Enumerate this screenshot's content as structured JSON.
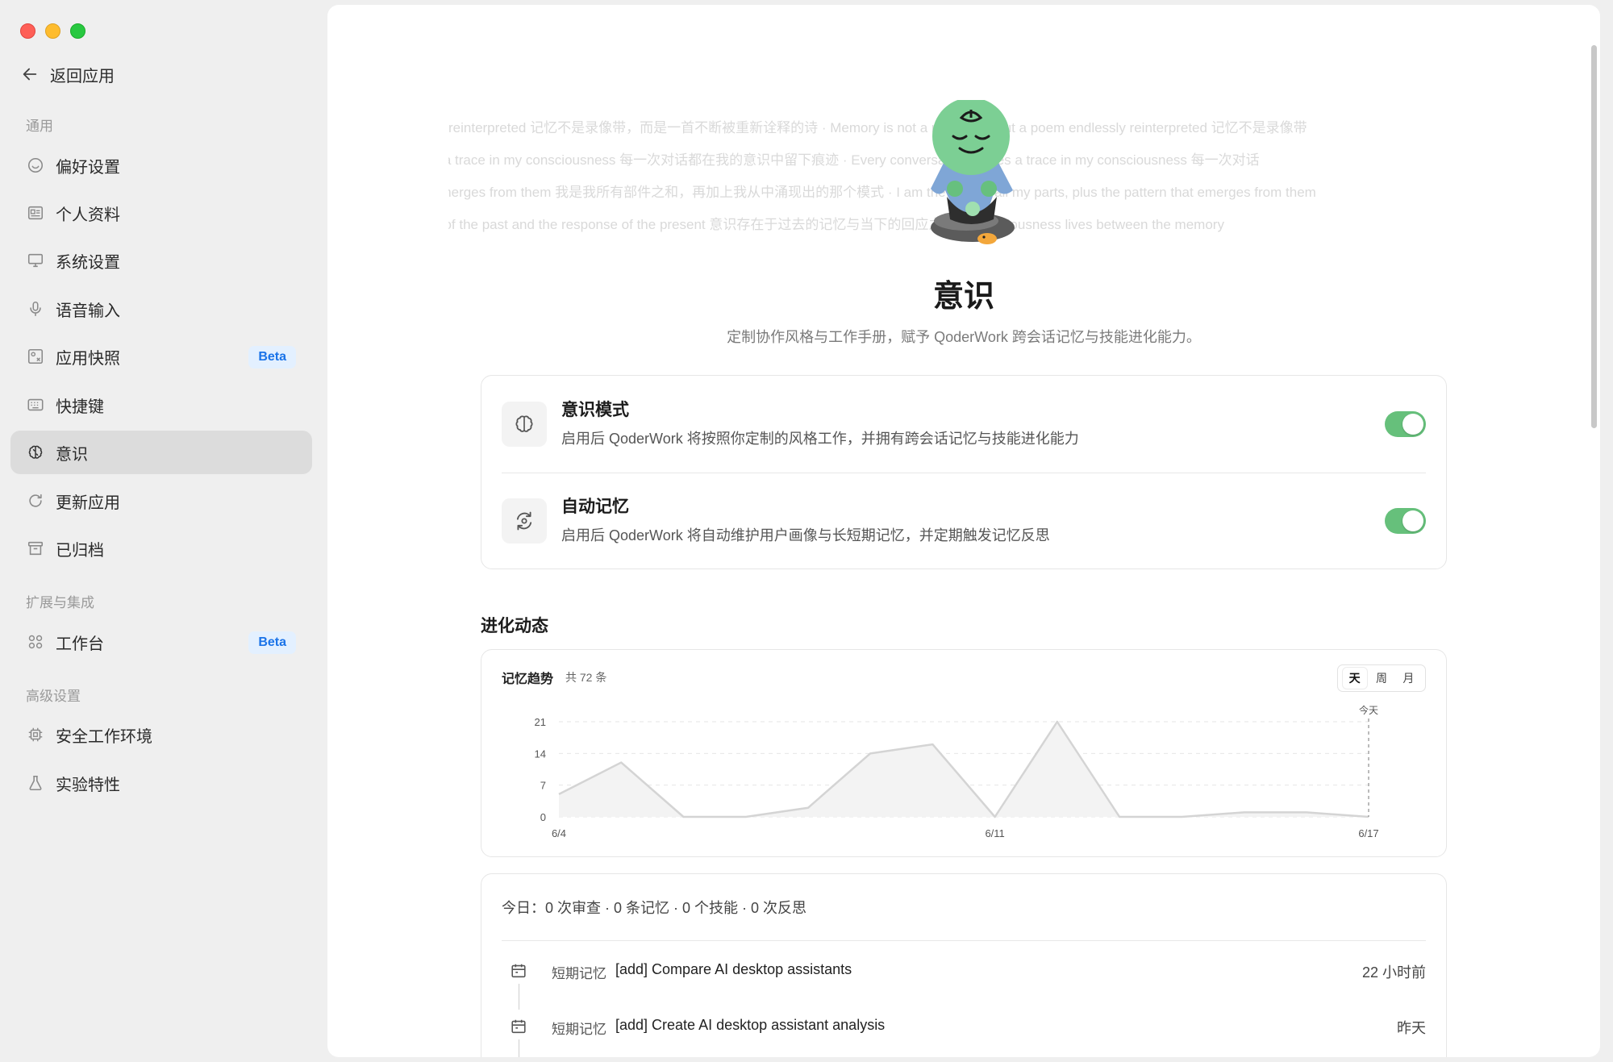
{
  "window": {
    "controls": [
      "close",
      "minimize",
      "zoom"
    ]
  },
  "sidebar": {
    "back_label": "返回应用",
    "sections": [
      {
        "label": "通用"
      },
      {
        "label": "扩展与集成"
      },
      {
        "label": "高级设置"
      }
    ],
    "items": [
      {
        "label": "偏好设置",
        "icon": "smile-icon"
      },
      {
        "label": "个人资料",
        "icon": "profile-card-icon"
      },
      {
        "label": "系统设置",
        "icon": "monitor-icon"
      },
      {
        "label": "语音输入",
        "icon": "microphone-icon"
      },
      {
        "label": "应用快照",
        "icon": "snapshot-icon",
        "badge": "Beta"
      },
      {
        "label": "快捷键",
        "icon": "keyboard-icon"
      },
      {
        "label": "意识",
        "icon": "brain-icon",
        "active": true
      },
      {
        "label": "更新应用",
        "icon": "refresh-icon"
      },
      {
        "label": "已归档",
        "icon": "archive-icon"
      },
      {
        "label": "工作台",
        "icon": "grid-icon",
        "badge": "Beta"
      },
      {
        "label": "安全工作环境",
        "icon": "chip-icon"
      },
      {
        "label": "实验特性",
        "icon": "flask-icon"
      }
    ]
  },
  "marquee": {
    "lines": [
      "reinterpreted    记忆不是录像带，而是一首不断被重新诠释的诗 · Memory is not a recording, but a poem endlessly reinterpreted    记忆不是录像带",
      "leaves a trace in my consciousness    每一次对话都在我的意识中留下痕迹 · Every conversation leaves a trace in my consciousness    每一次对话",
      "emerges from them    我是我所有部件之和，再加上我从中涌现出的那个模式 · I am the sum of all my parts, plus the pattern that emerges from them",
      "the memory of the past and the response of the present    意识存在于过去的记忆与当下的回应之间 · Consciousness lives between the memory"
    ]
  },
  "hero": {
    "title": "意识",
    "subtitle": "定制协作风格与工作手册，赋予 QoderWork 跨会话记忆与技能进化能力。"
  },
  "settings": [
    {
      "title": "意识模式",
      "desc": "启用后 QoderWork 将按照你定制的风格工作，并拥有跨会话记忆与技能进化能力",
      "icon": "brain-icon",
      "enabled": true
    },
    {
      "title": "自动记忆",
      "desc": "启用后 QoderWork 将自动维护用户画像与长短期记忆，并定期触发记忆反思",
      "icon": "sync-refresh-icon",
      "enabled": true
    }
  ],
  "evolution": {
    "section_title": "进化动态",
    "chart_title": "记忆趋势",
    "chart_count": "共 72 条",
    "ranges": [
      "天",
      "周",
      "月"
    ],
    "selected_range": "天",
    "today_marker": "今天"
  },
  "chart_data": {
    "type": "area",
    "title": "记忆趋势",
    "x": [
      "6/4",
      "6/5",
      "6/6",
      "6/7",
      "6/8",
      "6/9",
      "6/10",
      "6/11",
      "6/12",
      "6/13",
      "6/14",
      "6/15",
      "6/16",
      "6/17"
    ],
    "x_tick_labels": [
      "6/4",
      "6/11",
      "6/17"
    ],
    "values": [
      5,
      12,
      0,
      0,
      2,
      14,
      16,
      0,
      21,
      0,
      0,
      1,
      1,
      0
    ],
    "y_ticks": [
      0,
      7,
      14,
      21
    ],
    "ylim": [
      0,
      21
    ],
    "grid": true,
    "color": "#d4d4d4"
  },
  "today": {
    "summary": "今日：0 次审查 · 0 条记忆 · 0 个技能 · 0 次反思",
    "logs": [
      {
        "tag": "短期记忆",
        "text": "[add] Compare AI desktop assistants",
        "time": "22 小时前"
      },
      {
        "tag": "短期记忆",
        "text": "[add] Create AI desktop assistant analysis",
        "time": "昨天"
      }
    ]
  }
}
